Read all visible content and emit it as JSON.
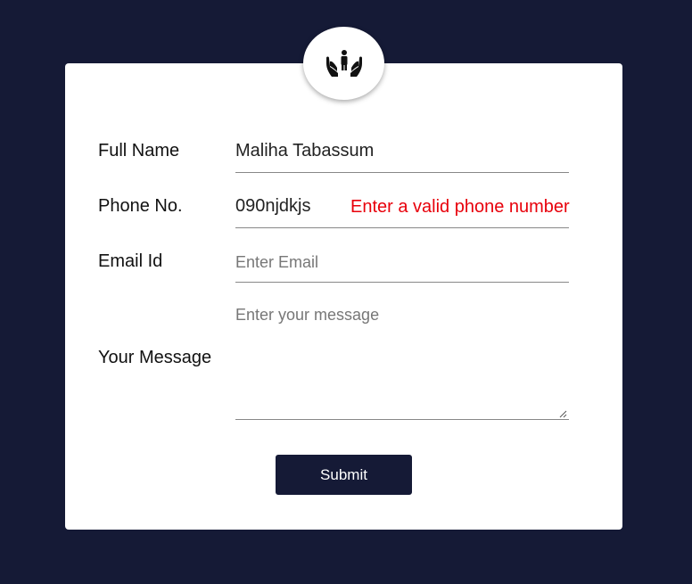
{
  "colors": {
    "background": "#151a36",
    "card": "#ffffff",
    "error": "#e8000b",
    "button": "#151a36"
  },
  "logo": {
    "icon": "hands-holding-child-icon"
  },
  "form": {
    "full_name": {
      "label": "Full Name",
      "value": "Maliha Tabassum"
    },
    "phone": {
      "label": "Phone No.",
      "value": "090njdkjs",
      "error": "Enter a valid phone number"
    },
    "email": {
      "label": "Email Id",
      "value": "",
      "placeholder": "Enter Email"
    },
    "message": {
      "label": "Your Message",
      "value": "",
      "placeholder": "Enter your message"
    },
    "submit_label": "Submit"
  }
}
